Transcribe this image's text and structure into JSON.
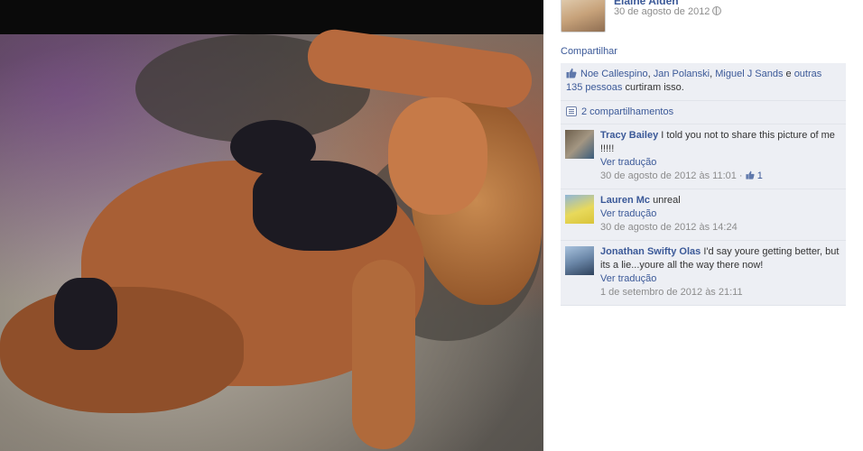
{
  "post": {
    "author": "Elaine Alden",
    "date": "30 de agosto de 2012",
    "share_label": "Compartilhar"
  },
  "likes": {
    "names": [
      "Noe Callespino",
      "Jan Polanski",
      "Miguel J Sands"
    ],
    "sep1": ", ",
    "sep2": ", ",
    "and": " e ",
    "others": "outras 135 pessoas",
    "suffix": " curtiram isso."
  },
  "shares": {
    "label": "2 compartilhamentos"
  },
  "comments": [
    {
      "author": "Tracy Bailey",
      "text": "I told you not to share this picture of me !!!!!",
      "translate": "Ver tradução",
      "time": "30 de agosto de 2012 às 11:01",
      "sep": " · ",
      "like_count": "1"
    },
    {
      "author": "Lauren Mc",
      "text": "unreal",
      "translate": "Ver tradução",
      "time": "30 de agosto de 2012 às 14:24"
    },
    {
      "author": "Jonathan Swifty Olas",
      "text": "I'd say youre getting better, but its a lie...youre all the way there now!",
      "translate": "Ver tradução",
      "time": "1 de setembro de 2012 às 21:11"
    }
  ],
  "colors": {
    "link": "#3b5998",
    "ufi_background": "#edeff4",
    "meta_text": "#8c8c8c"
  },
  "icons": [
    "globe-icon",
    "thumbs-up-icon",
    "share-icon"
  ]
}
